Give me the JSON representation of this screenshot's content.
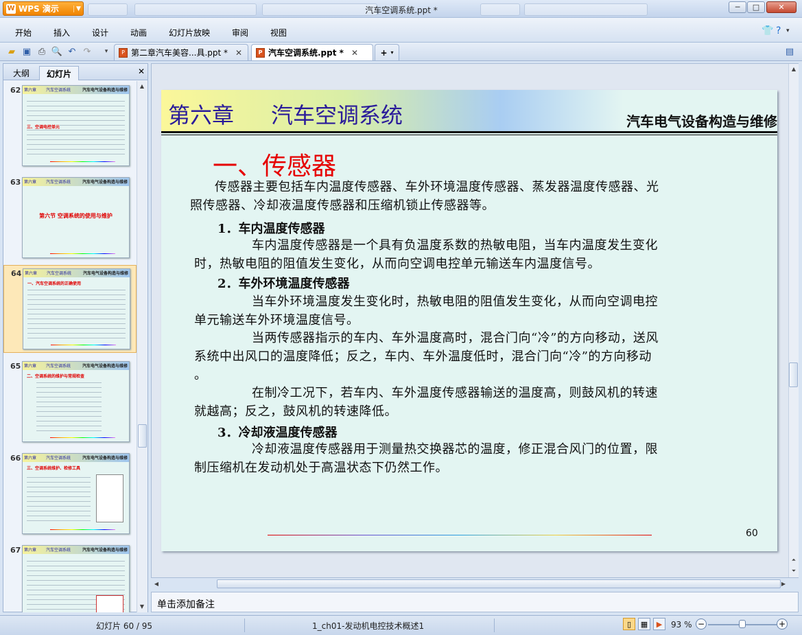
{
  "app": {
    "brand": "WPS 演示",
    "window_title": "汽车空调系统.ppt *",
    "win_buttons": [
      "─",
      "□",
      "✕"
    ]
  },
  "menu": [
    "开始",
    "插入",
    "设计",
    "动画",
    "幻灯片放映",
    "审阅",
    "视图"
  ],
  "tabs": [
    {
      "label": "第二章汽车美容...具.ppt *",
      "close": "✕"
    },
    {
      "label": "汽车空调系统.ppt *",
      "close": "✕"
    }
  ],
  "new_tab": "+",
  "left_panel": {
    "tabs": [
      "大纲",
      "幻灯片"
    ],
    "close": "✕",
    "thumbnails": [
      {
        "num": "62",
        "title": "三、空调电控单元"
      },
      {
        "num": "63",
        "title": "第六节 空调系统的使用与维护"
      },
      {
        "num": "64",
        "title": "一、汽车空调系统的正确使用"
      },
      {
        "num": "65",
        "title": "二、空调系统的维护与常规检查"
      },
      {
        "num": "66",
        "title": "三、空调系统维护、检修工具"
      },
      {
        "num": "67",
        "title": ""
      }
    ],
    "thumb_header": {
      "chapter": "第六章",
      "topic": "汽车空调系统",
      "course": "汽车电气设备构造与维修"
    }
  },
  "slide": {
    "chapter": "第六章",
    "topic": "汽车空调系统",
    "course": "汽车电气设备构造与维修",
    "section_title": "一、传感器",
    "intro_line1": "传感器主要包括车内温度传感器、车外环境温度传感器、蒸发器温度传感器、光",
    "intro_line2": "照传感器、冷却液温度传感器和压缩机锁止传感器等。",
    "h1": "1．车内温度传感器",
    "p1_line1": "车内温度传感器是一个具有负温度系数的热敏电阻，当车内温度发生变化",
    "p1_line2": "时，热敏电阻的阻值发生变化，从而向空调电控单元输送车内温度信号。",
    "h2": "2．车外环境温度传感器",
    "p2_line1": "当车外环境温度发生变化时，热敏电阻的阻值发生变化，从而向空调电控",
    "p2_line2": "单元输送车外环境温度信号。",
    "p3_line1": "当两传感器指示的车内、车外温度高时，混合门向“冷”的方向移动，送风",
    "p3_line2": "系统中出风口的温度降低；反之，车内、车外温度低时，混合门向“冷”的方向移动",
    "p3_line3": "。",
    "p4_line1": "在制冷工况下，若车内、车外温度传感器输送的温度高，则鼓风机的转速",
    "p4_line2": "就越高；反之，鼓风机的转速降低。",
    "h3": "3．冷却液温度传感器",
    "p5_line1": "冷却液温度传感器用于测量热交换器芯的温度，修正混合风门的位置，限",
    "p5_line2": "制压缩机在发动机处于高温状态下仍然工作。",
    "page_number": "60"
  },
  "notes_placeholder": "单击添加备注",
  "status": {
    "slide_info": "幻灯片 60 / 95",
    "template": "1_ch01-发动机电控技术概述1",
    "zoom": "93 %",
    "zoom_fraction": 0.5
  }
}
